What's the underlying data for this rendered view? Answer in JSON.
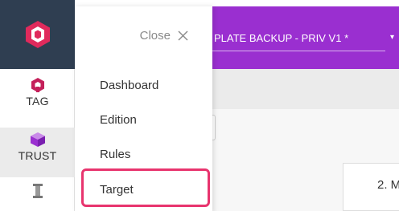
{
  "topbar": {
    "title": "PLATE BACKUP - PRIV V1 *",
    "caret": "▾",
    "color": "#9a2fd0"
  },
  "rail": {
    "logo_icon": "hexagon-logo-icon",
    "items": [
      {
        "label": "TAG",
        "icon": "tag-hexagon-icon",
        "color": "#c4205a"
      },
      {
        "label": "TRUST",
        "icon": "trust-cube-icon",
        "color": "#9a2fd0"
      },
      {
        "label": "",
        "icon": "column-icon",
        "color": "#777777"
      }
    ]
  },
  "menu": {
    "close_label": "Close",
    "close_icon": "close-icon",
    "items": [
      {
        "label": "Dashboard"
      },
      {
        "label": "Edition"
      },
      {
        "label": "Rules"
      },
      {
        "label": "Target"
      }
    ],
    "highlight_color": "#e8346e"
  },
  "card": {
    "title": "2. M"
  }
}
